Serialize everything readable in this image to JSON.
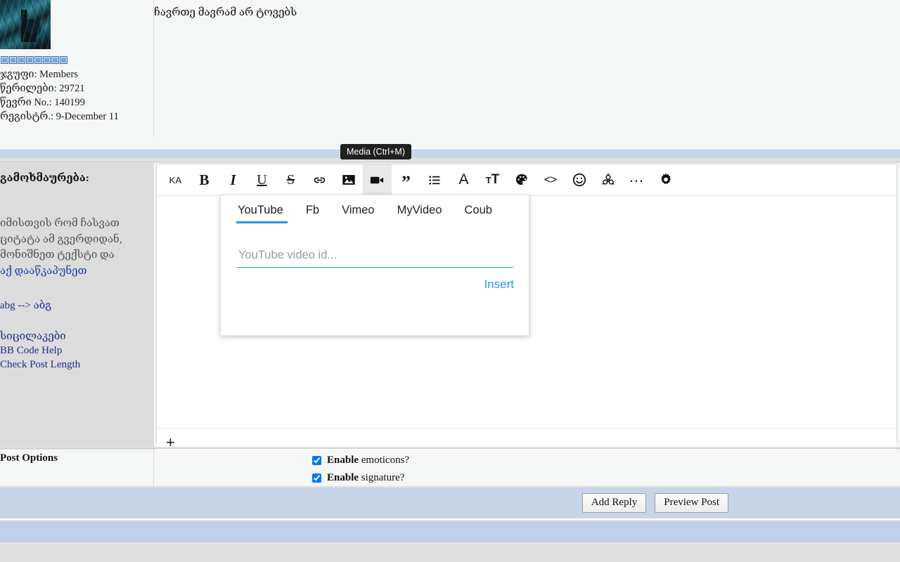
{
  "post": {
    "text": "ჩავრთე მავრამ არ ტოვებს",
    "avatar_alt": "user-avatar",
    "pip_count": 8,
    "pip_color": "#6f9fd8",
    "meta": [
      "ჯგუფი: Members",
      "წერილები: 29721",
      "წევრი No.: 140199",
      "რეგისტრ.: 9-December 11"
    ]
  },
  "editor": {
    "side_title": "გამოხმაურება:",
    "hint_lines": [
      "იმისთვის რომ ჩასვათ",
      "ციტატა ამ გვერდიდან,",
      "მონიშნეთ ტექსტი და"
    ],
    "hint_link": "აქ დააწკაპუნეთ",
    "smiley_note": "abg --> აბგ",
    "links": [
      "სიცილაკები",
      "BB Code Help",
      "Check Post Length"
    ],
    "add_button": "+",
    "toolbar": [
      {
        "name": "language-ka-button",
        "label": "KA",
        "kind": "ka",
        "active": false
      },
      {
        "name": "bold-button",
        "label": "B",
        "kind": "b",
        "active": false
      },
      {
        "name": "italic-button",
        "label": "I",
        "kind": "i",
        "active": false
      },
      {
        "name": "underline-button",
        "label": "U",
        "kind": "u",
        "active": false
      },
      {
        "name": "strikethrough-button",
        "label": "S",
        "kind": "s",
        "active": false
      },
      {
        "name": "link-icon",
        "label": "",
        "kind": "link",
        "active": false
      },
      {
        "name": "image-icon",
        "label": "",
        "kind": "image",
        "active": false
      },
      {
        "name": "media-video-icon",
        "label": "",
        "kind": "video",
        "active": true
      },
      {
        "name": "quote-button",
        "label": "”",
        "kind": "quote",
        "active": false
      },
      {
        "name": "list-icon",
        "label": "",
        "kind": "list",
        "active": false
      },
      {
        "name": "font-family-button",
        "label": "A",
        "kind": "font",
        "active": false
      },
      {
        "name": "font-size-button",
        "label": "T",
        "kind": "size",
        "active": false
      },
      {
        "name": "text-color-palette-icon",
        "label": "",
        "kind": "palette",
        "active": false
      },
      {
        "name": "source-code-button",
        "label": "<>",
        "kind": "code",
        "active": false
      },
      {
        "name": "emoticon-icon",
        "label": "",
        "kind": "smiley",
        "active": false
      },
      {
        "name": "spoiler-icon",
        "label": "",
        "kind": "biohazard",
        "active": false
      },
      {
        "name": "more-options-button",
        "label": "…",
        "kind": "dots",
        "active": false
      },
      {
        "name": "settings-gear-icon",
        "label": "",
        "kind": "gear",
        "active": false
      }
    ]
  },
  "tooltip": {
    "text": "Media (Ctrl+M)"
  },
  "media_popup": {
    "tabs": [
      {
        "label": "YouTube",
        "selected": true
      },
      {
        "label": "Fb",
        "selected": false
      },
      {
        "label": "Vimeo",
        "selected": false
      },
      {
        "label": "MyVideo",
        "selected": false
      },
      {
        "label": "Coub",
        "selected": false
      }
    ],
    "input_value": "",
    "input_placeholder": "YouTube video id...",
    "insert_label": "Insert",
    "accent_color": "#2196f3"
  },
  "post_options": {
    "title": "Post Options",
    "items": [
      {
        "strong": "Enable",
        "rest": " emoticons?",
        "checked": true
      },
      {
        "strong": "Enable",
        "rest": " signature?",
        "checked": true
      }
    ]
  },
  "actions": {
    "add_reply": "Add Reply",
    "preview_post": "Preview Post"
  },
  "colors": {
    "band_blue": "#c7d5e9",
    "page_gray": "#e2e2e2",
    "panel": "#f5f6f6",
    "link": "#1a2f8a"
  }
}
